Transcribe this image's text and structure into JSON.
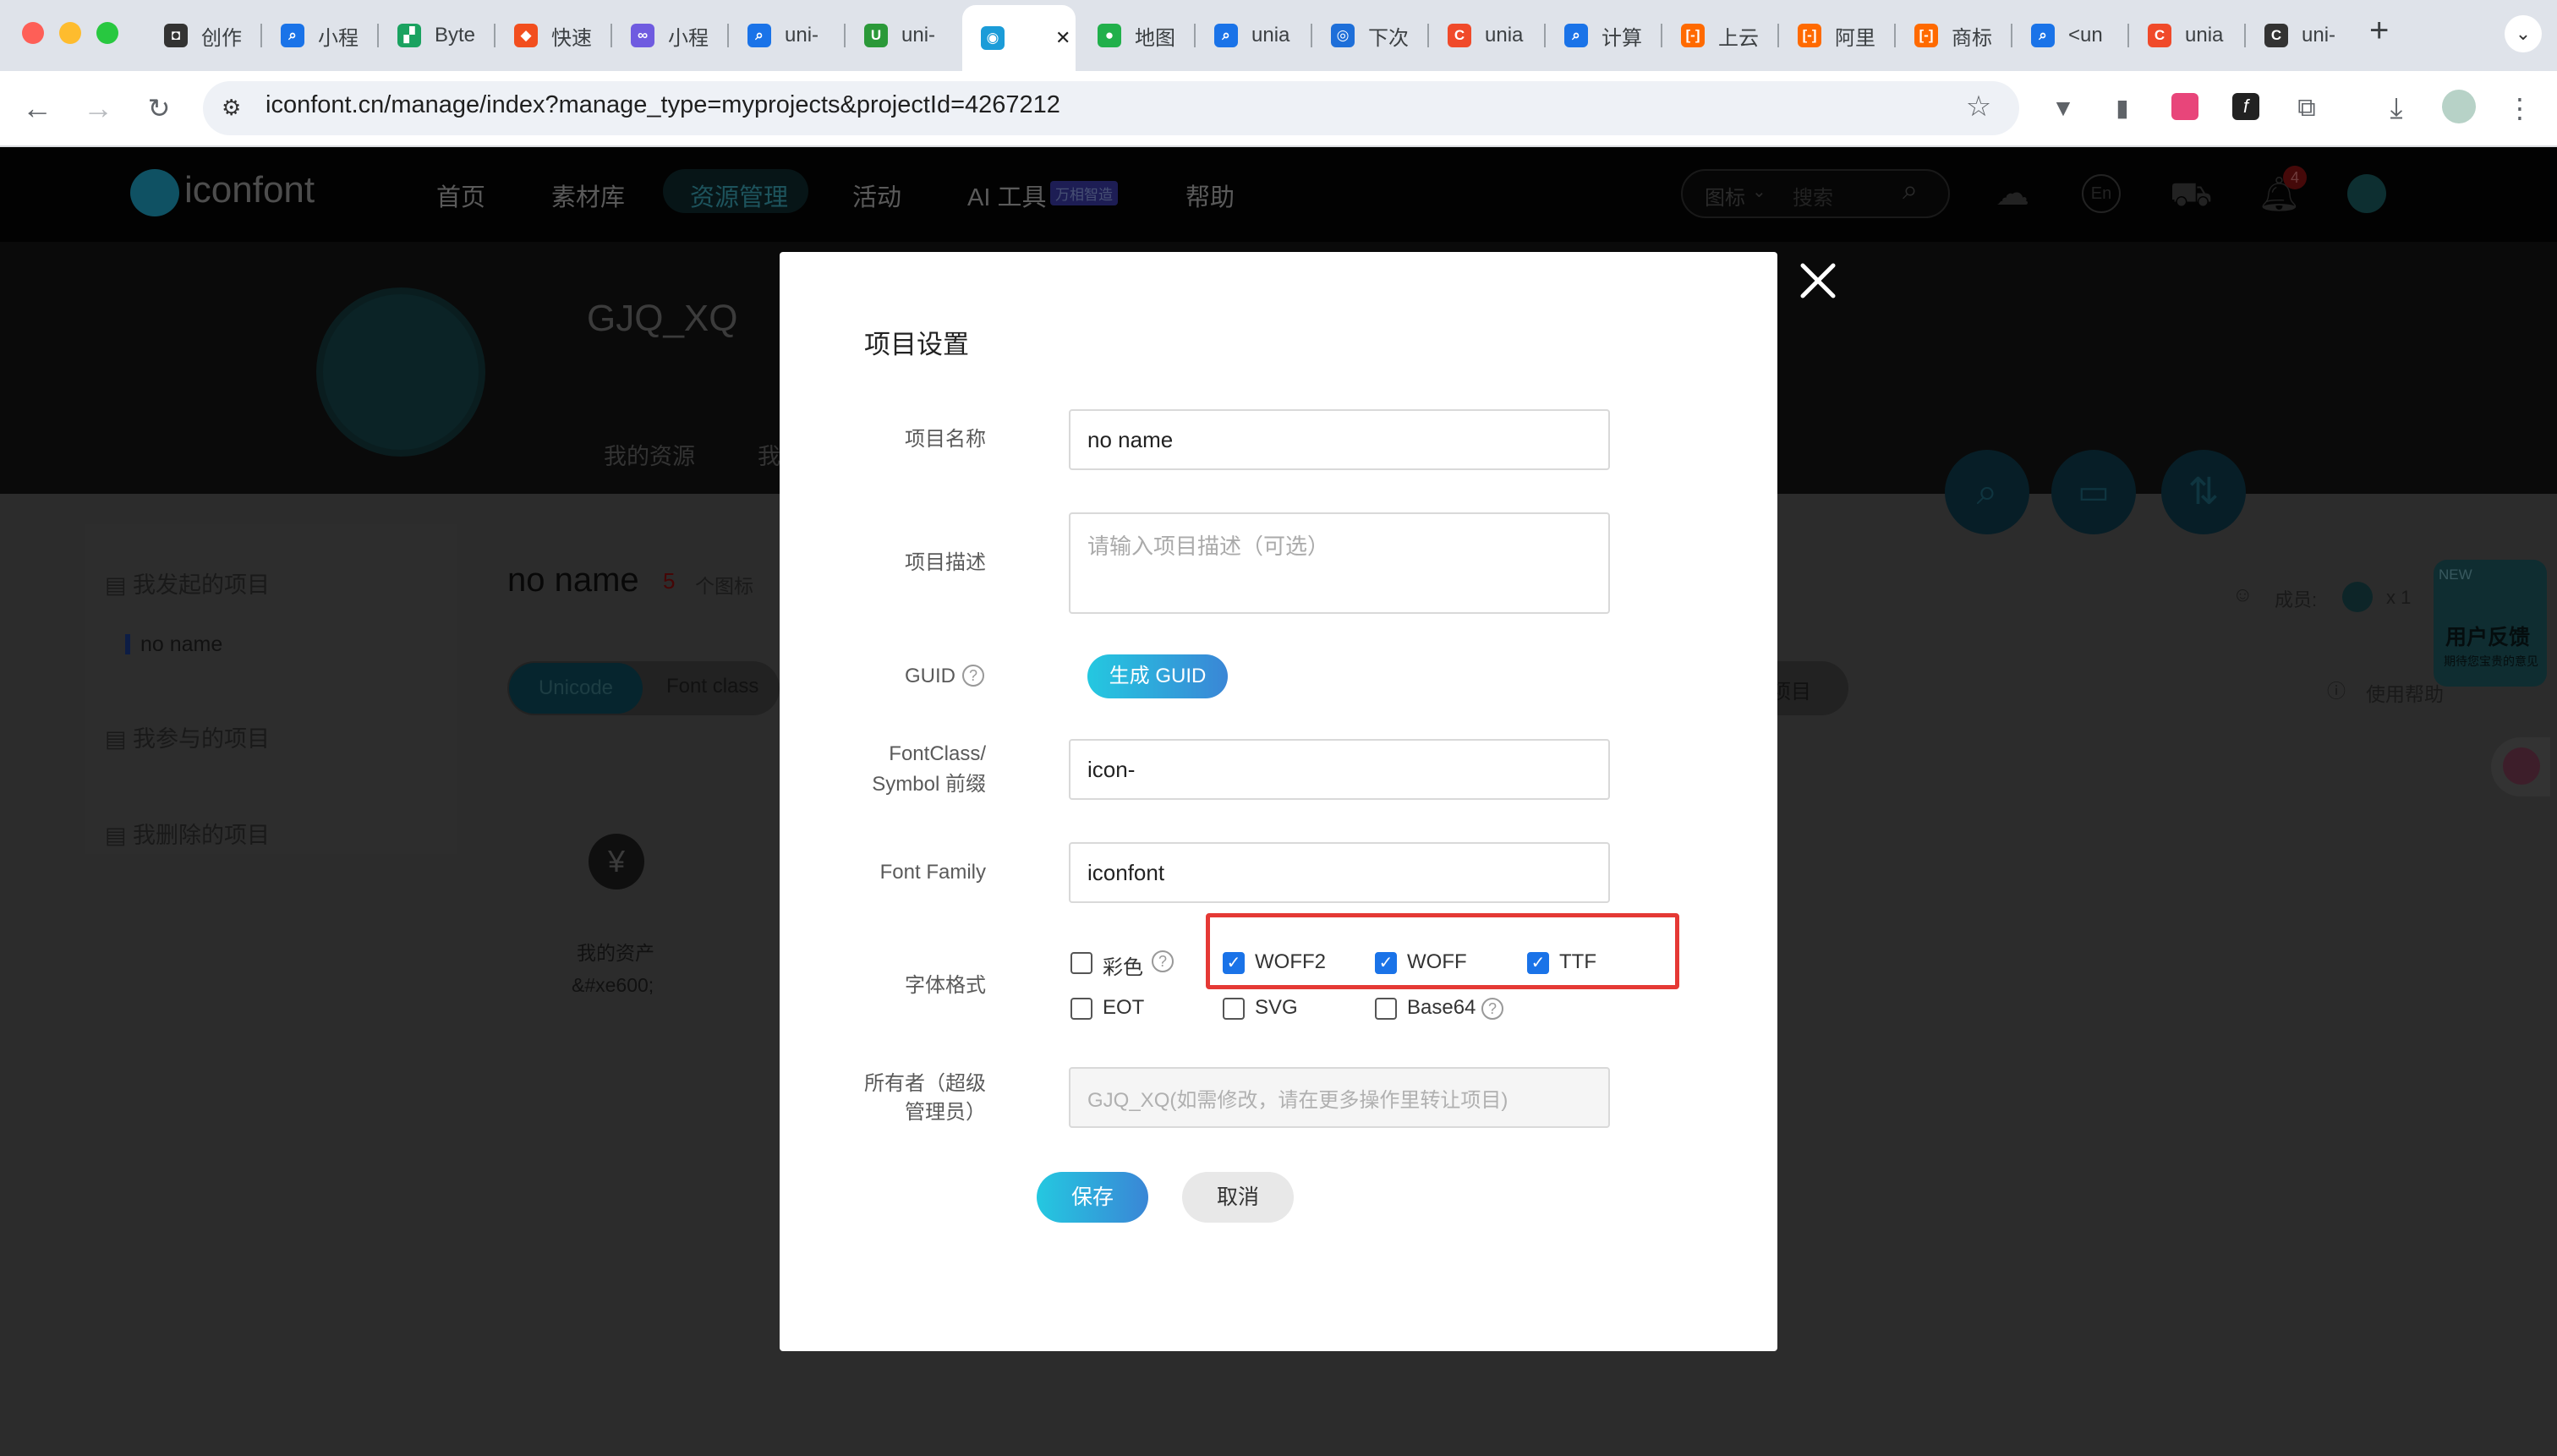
{
  "browser": {
    "tabs": [
      {
        "label": "创作",
        "color": "#333333",
        "glyph": "◘"
      },
      {
        "label": "小程",
        "color": "#1a73e8",
        "glyph": "⌕"
      },
      {
        "label": "Byte",
        "color": "#1aa260",
        "glyph": "▞"
      },
      {
        "label": "快速",
        "color": "#f24e1e",
        "glyph": "◆"
      },
      {
        "label": "小程",
        "color": "#6f5be0",
        "glyph": "∞"
      },
      {
        "label": "uni-",
        "color": "#1a73e8",
        "glyph": "⌕"
      },
      {
        "label": "uni-",
        "color": "#2b9939",
        "glyph": "U"
      },
      {
        "label": "",
        "color": "#1b9cd8",
        "glyph": "◉"
      },
      {
        "label": "地图",
        "color": "#21b04b",
        "glyph": "●"
      },
      {
        "label": "unia",
        "color": "#1a73e8",
        "glyph": "⌕"
      },
      {
        "label": "下次",
        "color": "#1e6fd9",
        "glyph": "◎"
      },
      {
        "label": "unia",
        "color": "#f04a2a",
        "glyph": "C"
      },
      {
        "label": "计算",
        "color": "#1a73e8",
        "glyph": "⌕"
      },
      {
        "label": "上云",
        "color": "#ff6a00",
        "glyph": "[-]"
      },
      {
        "label": "阿里",
        "color": "#ff6a00",
        "glyph": "[-]"
      },
      {
        "label": "商标",
        "color": "#ff6a00",
        "glyph": "[-]"
      },
      {
        "label": "<un",
        "color": "#1a73e8",
        "glyph": "⌕"
      },
      {
        "label": "unia",
        "color": "#f04a2a",
        "glyph": "C"
      },
      {
        "label": "uni-",
        "color": "#333333",
        "glyph": "C"
      }
    ],
    "url": "iconfont.cn/manage/index?manage_type=myprojects&projectId=4267212"
  },
  "site": {
    "logo": "iconfont",
    "nav": [
      "首页",
      "素材库",
      "资源管理",
      "活动",
      "AI 工具",
      "帮助"
    ],
    "ai_badge": "万相智造",
    "search_type": "图标",
    "search_placeholder": "搜索",
    "notification_count": "4",
    "lang": "En",
    "username": "GJQ_XQ",
    "profile_tab": "我的资源",
    "profile_tab2": "我",
    "sidebar": {
      "started": "我发起的项目",
      "project": "no name",
      "joined": "我参与的项目",
      "deleted": "我删除的项目"
    },
    "project_title": "no name",
    "icon_count": "5",
    "icon_count_label": "个图标",
    "tab_unicode": "Unicode",
    "tab_fontclass": "Font class",
    "more_label": "项目",
    "members_label": "成员:",
    "members_count": "x 1",
    "help_label": "使用帮助",
    "feedback": "用户反馈",
    "feedback_sub": "期待您宝贵的意见",
    "feedback_new": "NEW",
    "icon_name": "我的资产",
    "icon_code": "&#xe600;"
  },
  "modal": {
    "title": "项目设置",
    "fields": {
      "name_label": "项目名称",
      "name_value": "no name",
      "desc_label": "项目描述",
      "desc_placeholder": "请输入项目描述（可选）",
      "guid_label": "GUID",
      "guid_button": "生成 GUID",
      "prefix_label_1": "FontClass/",
      "prefix_label_2": "Symbol 前缀",
      "prefix_value": "icon-",
      "family_label": "Font Family",
      "family_value": "iconfont",
      "format_label": "字体格式",
      "owner_label_1": "所有者（超级",
      "owner_label_2": "管理员）",
      "owner_placeholder": "GJQ_XQ(如需修改，请在更多操作里转让项目)"
    },
    "formats": [
      {
        "label": "彩色",
        "checked": false,
        "help": true
      },
      {
        "label": "WOFF2",
        "checked": true
      },
      {
        "label": "WOFF",
        "checked": true
      },
      {
        "label": "TTF",
        "checked": true
      },
      {
        "label": "EOT",
        "checked": false
      },
      {
        "label": "SVG",
        "checked": false
      },
      {
        "label": "Base64",
        "checked": false,
        "help": true
      }
    ],
    "save": "保存",
    "cancel": "取消",
    "highlight_color": "#e53935"
  }
}
